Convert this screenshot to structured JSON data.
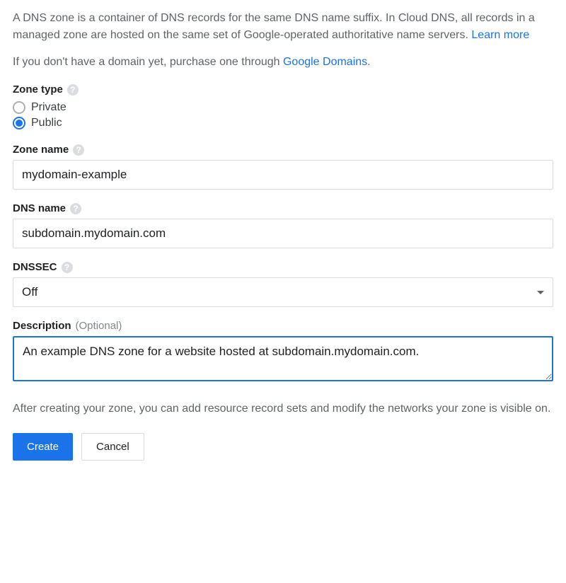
{
  "intro": {
    "text_a": "A DNS zone is a container of DNS records for the same DNS name suffix. In Cloud DNS, all records in a managed zone are hosted on the same set of Google-operated authoritative name servers. ",
    "learn_more": "Learn more",
    "text_b": "If you don't have a domain yet, purchase one through ",
    "google_domains": "Google Domains",
    "period": "."
  },
  "zone_type": {
    "label": "Zone type",
    "options": {
      "private": "Private",
      "public": "Public"
    },
    "selected": "public"
  },
  "zone_name": {
    "label": "Zone name",
    "value": "mydomain-example"
  },
  "dns_name": {
    "label": "DNS name",
    "value": "subdomain.mydomain.com"
  },
  "dnssec": {
    "label": "DNSSEC",
    "value": "Off"
  },
  "description": {
    "label": "Description",
    "optional": "(Optional)",
    "value": "An example DNS zone for a website hosted at subdomain.mydomain.com."
  },
  "after_text": "After creating your zone, you can add resource record sets and modify the networks your zone is visible on.",
  "buttons": {
    "create": "Create",
    "cancel": "Cancel"
  },
  "help_glyph": "?"
}
